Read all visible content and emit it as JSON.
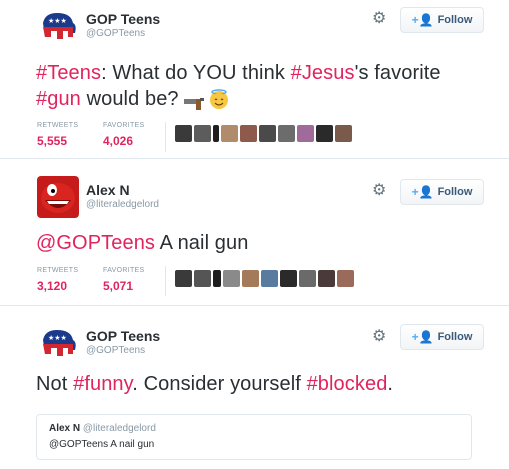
{
  "tweets": [
    {
      "name": "GOP Teens",
      "handle": "@GOPTeens",
      "follow_label": "Follow",
      "text": [
        {
          "t": "#Teens",
          "tag": true
        },
        {
          "t": ": What do YOU think ",
          "tag": false
        },
        {
          "t": "#Jesus",
          "tag": true
        },
        {
          "t": "'s favorite",
          "tag": false
        }
      ],
      "text_line2": [
        {
          "t": "#gun",
          "tag": true
        },
        {
          "t": " would be? ",
          "tag": false
        }
      ],
      "retweets_label": "RETWEETS",
      "retweets": "5,555",
      "favorites_label": "FAVORITES",
      "favorites": "4,026"
    },
    {
      "name": "Alex N",
      "handle": "@literaledgelord",
      "follow_label": "Follow",
      "text": [
        {
          "t": "@GOPTeens",
          "tag": true
        },
        {
          "t": " A nail gun",
          "tag": false
        }
      ],
      "retweets_label": "RETWEETS",
      "retweets": "3,120",
      "favorites_label": "FAVORITES",
      "favorites": "5,071"
    },
    {
      "name": "GOP Teens",
      "handle": "@GOPTeens",
      "follow_label": "Follow",
      "text": [
        {
          "t": "Not ",
          "tag": false
        },
        {
          "t": "#funny",
          "tag": true
        },
        {
          "t": ". Consider yourself ",
          "tag": false
        },
        {
          "t": "#blocked",
          "tag": true
        },
        {
          "t": ".",
          "tag": false
        }
      ],
      "quote": {
        "name": "Alex N",
        "handle": "@literaledgelord",
        "text": "@GOPTeens A nail gun"
      }
    }
  ],
  "colors": {
    "hashtag": "#e0245e",
    "follow_plus": "#55acee",
    "muted": "#8899a6"
  },
  "icons": [
    "elephant-logo-icon",
    "gear-icon",
    "follow-person-icon",
    "gun-emoji-icon",
    "halo-smile-emoji-icon"
  ]
}
